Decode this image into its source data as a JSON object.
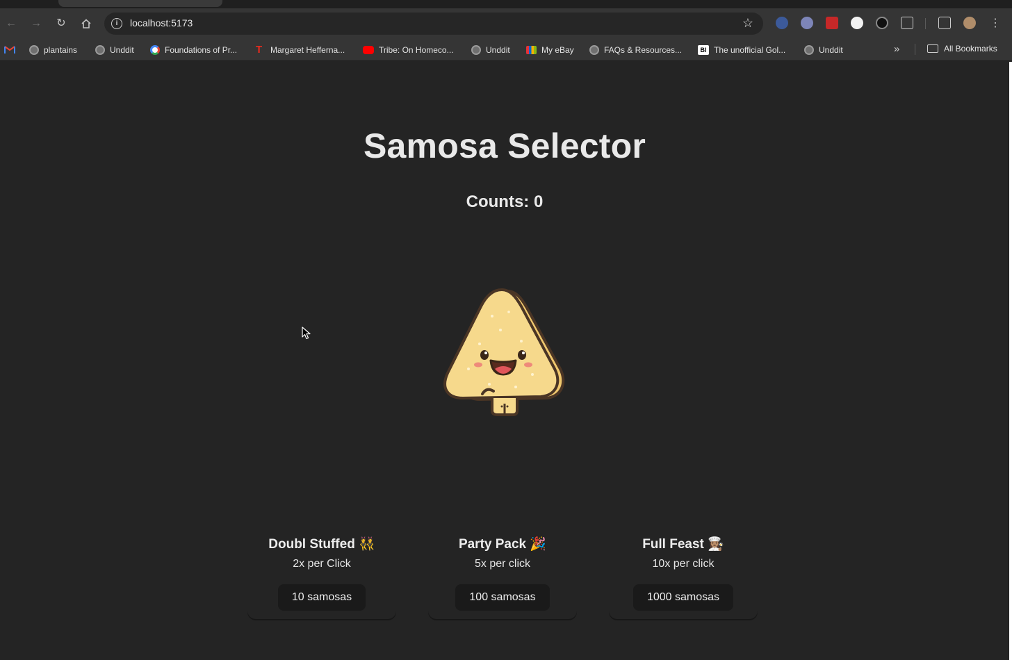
{
  "browser": {
    "url": "localhost:5173",
    "bookmarks": [
      {
        "label": "plantains",
        "icon": "globe-icon"
      },
      {
        "label": "Unddit",
        "icon": "globe-icon"
      },
      {
        "label": "Foundations of Pr...",
        "icon": "google-icon"
      },
      {
        "label": "Margaret Hefferna...",
        "icon": "ted-icon"
      },
      {
        "label": "Tribe: On Homeco...",
        "icon": "youtube-icon"
      },
      {
        "label": "Unddit",
        "icon": "globe-icon"
      },
      {
        "label": "My eBay",
        "icon": "ebay-icon"
      },
      {
        "label": "FAQs & Resources...",
        "icon": "globe-icon"
      },
      {
        "label": "The unofficial Gol...",
        "icon": "bi-icon"
      },
      {
        "label": "Unddit",
        "icon": "globe-icon"
      }
    ],
    "all_bookmarks_label": "All Bookmarks",
    "bi_badge": "BI"
  },
  "app": {
    "title": "Samosa Selector",
    "counts_label": "Counts: 0"
  },
  "upgrades": [
    {
      "name": "Doubl Stuffed 👯",
      "rate": "2x per Click",
      "cost": "10 samosas"
    },
    {
      "name": "Party Pack 🎉",
      "rate": "5x per click",
      "cost": "100 samosas"
    },
    {
      "name": "Full Feast 👩🏽‍🍳",
      "rate": "10x per click",
      "cost": "1000 samosas"
    }
  ],
  "colors": {
    "background": "#242424",
    "text": "#e9e9e9",
    "button": "#1a1a1a",
    "samosa_fill": "#f6d98c",
    "samosa_outline": "#4a3525"
  }
}
